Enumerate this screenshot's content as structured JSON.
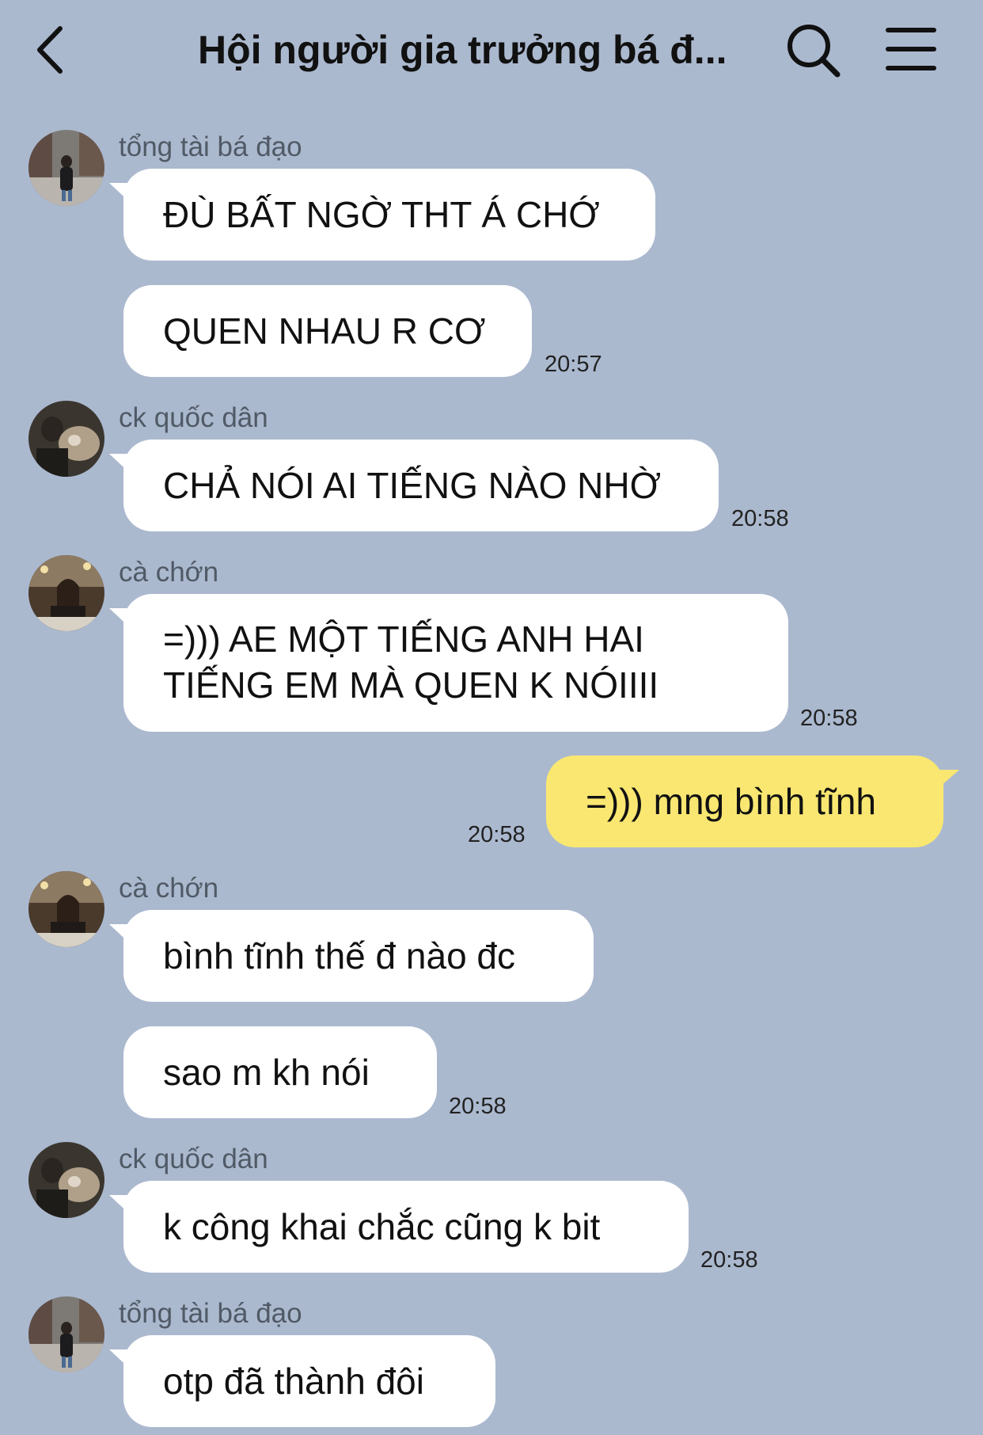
{
  "header": {
    "title": "Hội người gia trưởng bá đ...",
    "back_icon": "chevron-left-icon",
    "search_icon": "search-icon",
    "menu_icon": "hamburger-menu-icon"
  },
  "colors": {
    "background": "#abb9cf",
    "incoming_bubble": "#ffffff",
    "outgoing_bubble": "#f9e771"
  },
  "messages": [
    {
      "sender": "tổng tài bá đạo",
      "text": "ĐÙ BẤT NGỜ THT Á CHỚ"
    },
    {
      "text": "QUEN NHAU R CƠ",
      "time": "20:57"
    },
    {
      "sender": "ck quốc dân",
      "text": "CHẢ NÓI AI TIẾNG NÀO NHỜ",
      "time": "20:58"
    },
    {
      "sender": "cà chớn",
      "text_lines": [
        "=))) AE MỘT TIẾNG ANH HAI",
        "TIẾNG EM MÀ QUEN K NÓIIII"
      ],
      "time": "20:58"
    },
    {
      "outgoing": true,
      "text": "=))) mng bình tĩnh",
      "time": "20:58"
    },
    {
      "sender": "cà chớn",
      "text": "bình tĩnh thế đ nào đc"
    },
    {
      "text": "sao m kh nói",
      "time": "20:58"
    },
    {
      "sender": "ck quốc dân",
      "text": "k công khai chắc cũng k bit",
      "time": "20:58"
    },
    {
      "sender": "tổng tài bá đạo",
      "text": "otp đã thành đôi"
    }
  ]
}
